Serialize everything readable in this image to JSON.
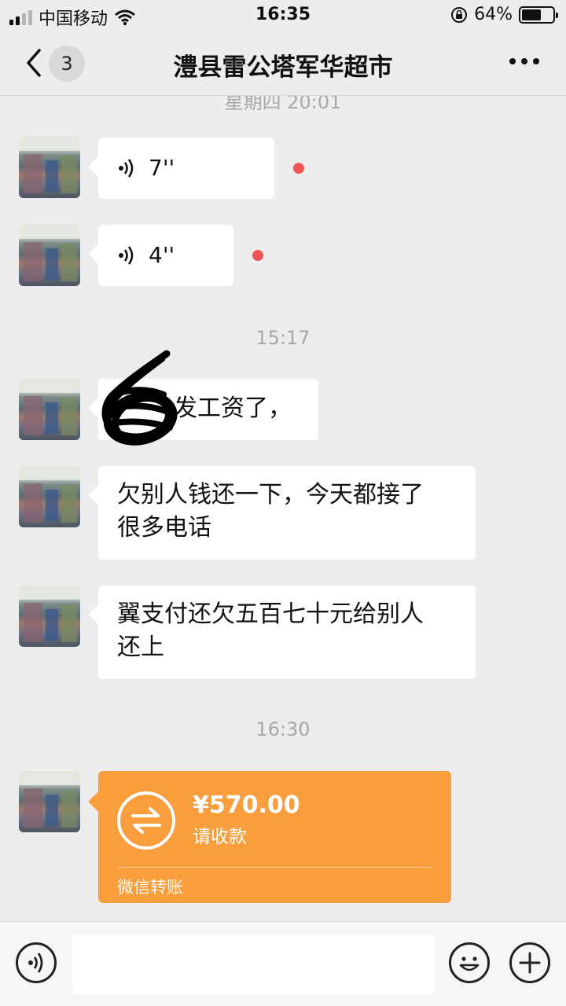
{
  "status_bar": {
    "carrier": "中国移动",
    "time": "16:35",
    "battery_percent": "64%",
    "battery_level": 0.64
  },
  "nav": {
    "unread_count": "3",
    "title": "澧县雷公塔军华超市"
  },
  "messages": {
    "ts_partial": "星期四 20:01",
    "voice_1_duration": "7''",
    "voice_2_duration": "4''",
    "ts_1": "15:17",
    "msg_1": "发工资了，",
    "msg_2_line1": "欠别人钱还一下，今天都接了",
    "msg_2_line2": "很多电话",
    "msg_3_line1": "翼支付还欠五百七十元给别人",
    "msg_3_line2": "还上",
    "ts_2": "16:30",
    "transfer_amount": "¥570.00",
    "transfer_status": "请收款",
    "transfer_source": "微信转账"
  },
  "colors": {
    "transfer_orange": "#f89e3c",
    "unread_dot": "#f25555",
    "background": "#ededed"
  },
  "icons": {
    "back": "chevron-left-icon",
    "more": "more-dots-icon",
    "voice": "voice-wave-icon",
    "transfer": "transfer-arrows-icon",
    "emoji": "emoji-icon",
    "plus": "plus-icon"
  }
}
